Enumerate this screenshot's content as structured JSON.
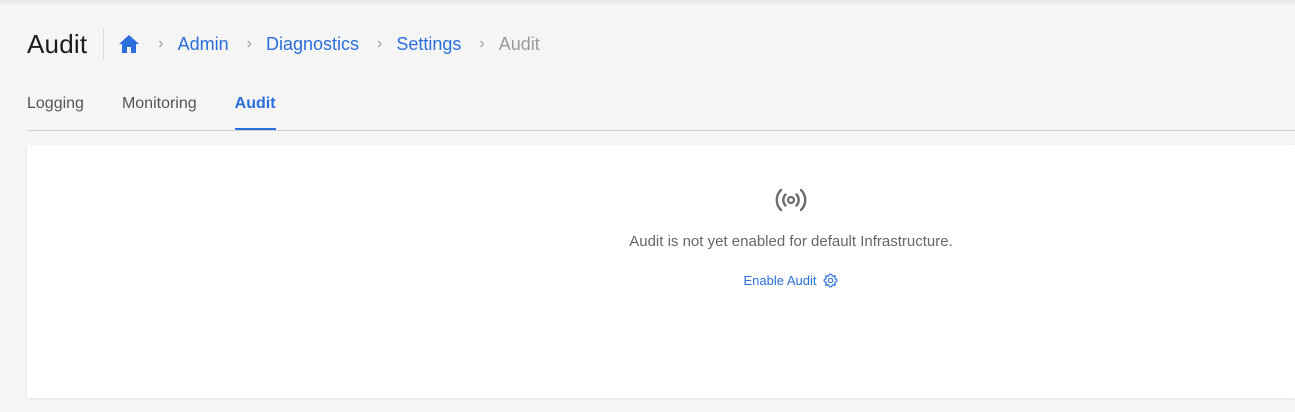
{
  "header": {
    "title": "Audit",
    "breadcrumb": {
      "home_icon": "home-icon",
      "separator": "›",
      "items": [
        {
          "label": "Admin"
        },
        {
          "label": "Diagnostics"
        },
        {
          "label": "Settings"
        }
      ],
      "current": "Audit"
    }
  },
  "tabs": [
    {
      "label": "Logging",
      "active": false
    },
    {
      "label": "Monitoring",
      "active": false
    },
    {
      "label": "Audit",
      "active": true
    }
  ],
  "empty_state": {
    "icon": "broadcast-signal-icon",
    "message": "Audit is not yet enabled for default Infrastructure.",
    "action_label": "Enable Audit",
    "action_icon": "gear-icon"
  },
  "colors": {
    "accent": "#2a6fdb",
    "background": "#f5f5f5",
    "card": "#ffffff",
    "muted_text": "#9a9a9a"
  }
}
